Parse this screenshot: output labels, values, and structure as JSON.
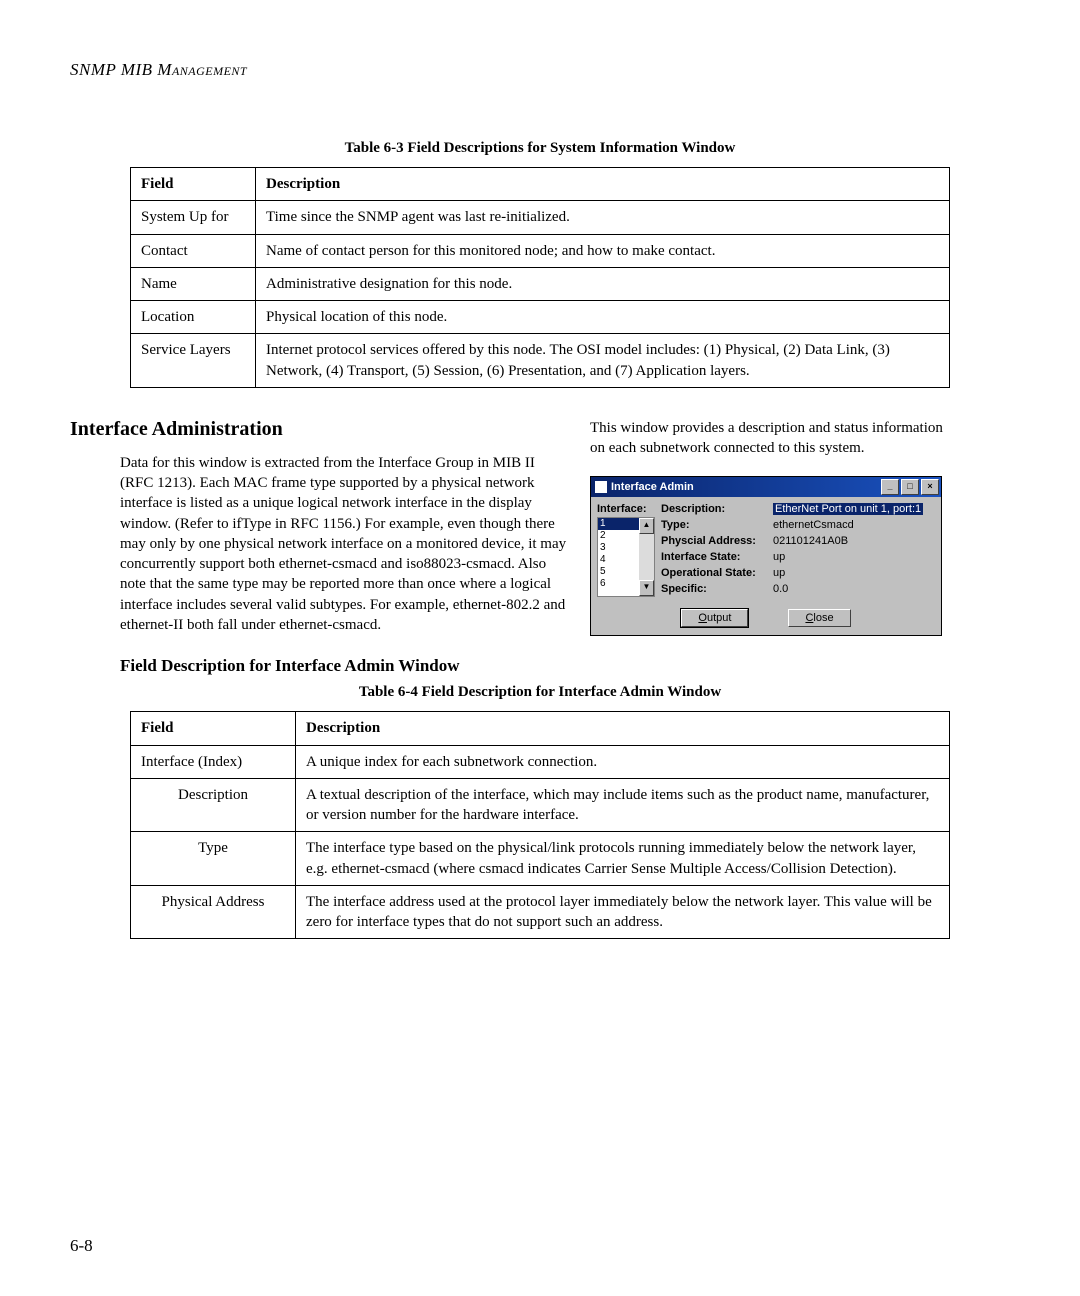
{
  "running_head": "SNMP MIB Management",
  "table63": {
    "caption": "Table 6-3  Field Descriptions for System Information Window",
    "head_field": "Field",
    "head_desc": "Description",
    "rows": [
      {
        "field": "System Up for",
        "desc": "Time since the SNMP agent was last re-initialized."
      },
      {
        "field": "Contact",
        "desc": "Name of contact person for this monitored node; and how to make contact."
      },
      {
        "field": "Name",
        "desc": "Administrative designation for this node."
      },
      {
        "field": "Location",
        "desc": "Physical location of this node."
      },
      {
        "field": "Service Layers",
        "desc": "Internet protocol services offered by this node. The OSI model includes: (1) Physical, (2) Data Link, (3) Network, (4) Transport, (5) Session, (6) Presentation, and (7) Application layers."
      }
    ]
  },
  "section_heading": "Interface Administration",
  "section_left_para": "Data for this window is extracted from the Interface Group in MIB II (RFC 1213). Each MAC frame type supported by a physical network interface is listed as a unique logical network interface in the display window. (Refer to ifType in RFC 1156.) For example, even though there may only by one physical network interface on a monitored device, it may concurrently support both ethernet-csmacd and iso88023-csmacd. Also note that the same type may be reported more than once where a logical interface includes several valid subtypes. For example, ethernet-802.2 and ethernet-II both fall under ethernet-csmacd.",
  "section_right_para": "This window provides a description and status information on each subnetwork connected to this system.",
  "dialog": {
    "title": "Interface Admin",
    "min_label": "_",
    "max_label": "□",
    "close_label": "×",
    "iface_label": "Interface:",
    "list_items": [
      "1",
      "2",
      "3",
      "4",
      "5",
      "6"
    ],
    "selected_index": 0,
    "scroll_up": "▲",
    "scroll_down": "▼",
    "labels": {
      "desc": "Description:",
      "type": "Type:",
      "phys": "Physcial Address:",
      "istate": "Interface State:",
      "ostate": "Operational State:",
      "specific": "Specific:"
    },
    "values": {
      "desc": "EtherNet Port on unit 1, port:1",
      "type": "ethernetCsmacd",
      "phys": "021101241A0B",
      "istate": "up",
      "ostate": "up",
      "specific": "0.0"
    },
    "output_btn_pre": "O",
    "output_btn_rest": "utput",
    "close_btn_pre": "C",
    "close_btn_rest": "lose"
  },
  "subsection_heading": "Field Description for Interface Admin Window",
  "table64": {
    "caption": "Table 6-4  Field Description for Interface Admin Window",
    "head_field": "Field",
    "head_desc": "Description",
    "rows": [
      {
        "field": "Interface (Index)",
        "desc": "A unique index for each subnetwork connection."
      },
      {
        "field": "Description",
        "desc": "A textual description of the interface, which may include items such as the product name, manufacturer, or version number for the hardware interface."
      },
      {
        "field": "Type",
        "desc": "The interface type based on the physical/link protocols running immediately below the network layer, e.g. ethernet-csmacd (where csmacd indicates Carrier Sense Multiple Access/Collision Detection)."
      },
      {
        "field": "Physical Address",
        "desc": "The interface address used at the protocol layer immediately below the network layer. This value will be zero for interface types that do not support such an address."
      }
    ]
  },
  "page_number": "6-8"
}
